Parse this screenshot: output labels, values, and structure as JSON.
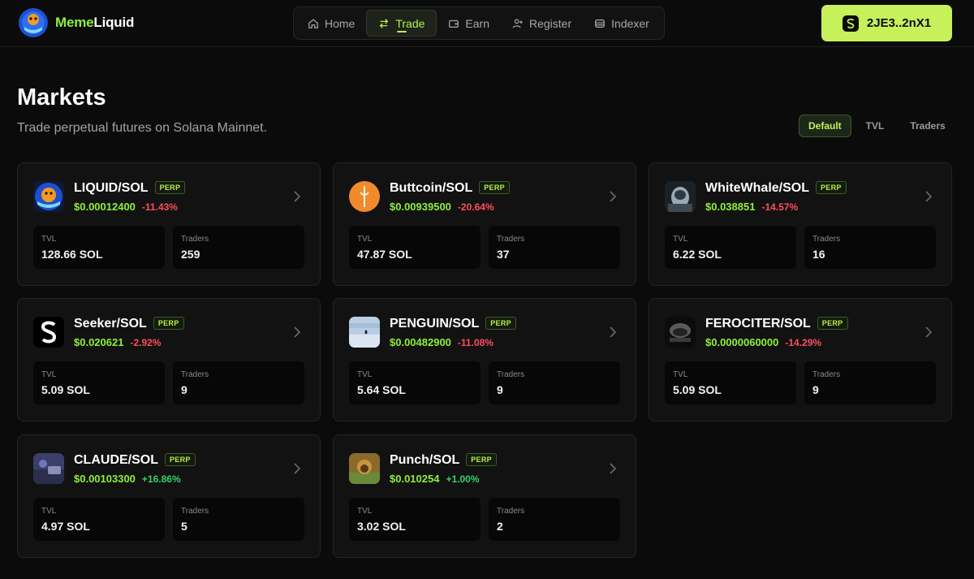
{
  "brand": {
    "name_part1": "Meme",
    "name_part2": "Liquid"
  },
  "nav": {
    "items": [
      {
        "label": "Home",
        "icon": "home-icon"
      },
      {
        "label": "Trade",
        "icon": "swap-icon"
      },
      {
        "label": "Earn",
        "icon": "wallet-icon"
      },
      {
        "label": "Register",
        "icon": "user-plus-icon"
      },
      {
        "label": "Indexer",
        "icon": "database-icon"
      }
    ],
    "active": "Trade"
  },
  "wallet": {
    "label": "2JE3..2nX1",
    "icon": "solana-s-icon"
  },
  "page": {
    "title": "Markets",
    "subtitle": "Trade perpetual futures on Solana Mainnet."
  },
  "sort": {
    "options": [
      "Default",
      "TVL",
      "Traders"
    ],
    "active": "Default"
  },
  "labels": {
    "perp": "PERP",
    "tvl": "TVL",
    "traders": "Traders"
  },
  "markets": [
    {
      "name": "LIQUID/SOL",
      "price": "$0.00012400",
      "change": "-11.43%",
      "direction": "neg",
      "tvl": "128.66 SOL",
      "traders": "259",
      "avatar": "liquid-logo"
    },
    {
      "name": "Buttcoin/SOL",
      "price": "$0.00939500",
      "change": "-20.64%",
      "direction": "neg",
      "tvl": "47.87 SOL",
      "traders": "37",
      "avatar": "buttcoin-logo"
    },
    {
      "name": "WhiteWhale/SOL",
      "price": "$0.038851",
      "change": "-14.57%",
      "direction": "neg",
      "tvl": "6.22 SOL",
      "traders": "16",
      "avatar": "whitewhale-logo"
    },
    {
      "name": "Seeker/SOL",
      "price": "$0.020621",
      "change": "-2.92%",
      "direction": "neg",
      "tvl": "5.09 SOL",
      "traders": "9",
      "avatar": "seeker-logo"
    },
    {
      "name": "PENGUIN/SOL",
      "price": "$0.00482900",
      "change": "-11.08%",
      "direction": "neg",
      "tvl": "5.64 SOL",
      "traders": "9",
      "avatar": "penguin-logo"
    },
    {
      "name": "FEROCITER/SOL",
      "price": "$0.0000060000",
      "change": "-14.29%",
      "direction": "neg",
      "tvl": "5.09 SOL",
      "traders": "9",
      "avatar": "ferociter-logo"
    },
    {
      "name": "CLAUDE/SOL",
      "price": "$0.00103300",
      "change": "+16.86%",
      "direction": "pos",
      "tvl": "4.97 SOL",
      "traders": "5",
      "avatar": "claude-logo"
    },
    {
      "name": "Punch/SOL",
      "price": "$0.010254",
      "change": "+1.00%",
      "direction": "pos",
      "tvl": "3.02 SOL",
      "traders": "2",
      "avatar": "punch-logo"
    }
  ]
}
